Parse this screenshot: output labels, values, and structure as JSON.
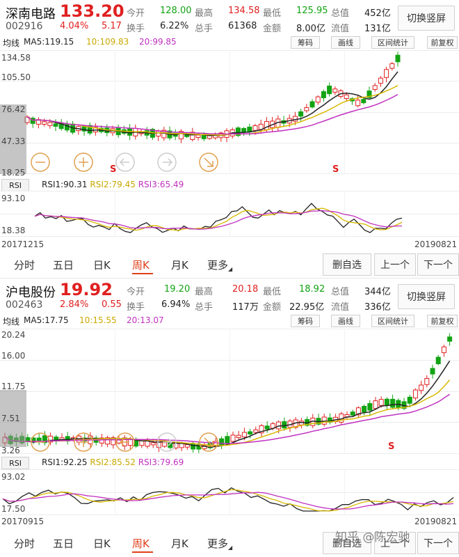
{
  "panels": [
    {
      "name": "深南电路",
      "code": "002916",
      "price": "133.20",
      "pct": "4.04%",
      "change": "5.17",
      "stats": [
        {
          "label": "今开",
          "value": "128.00",
          "color": "green"
        },
        {
          "label": "最高",
          "value": "134.58",
          "color": "red"
        },
        {
          "label": "最低",
          "value": "125.95",
          "color": "green"
        },
        {
          "label": "总值",
          "value": "452亿",
          "color": "dark"
        },
        {
          "label": "换手",
          "value": "6.22%",
          "color": "dark"
        },
        {
          "label": "总手",
          "value": "61368",
          "color": "dark"
        },
        {
          "label": "金额",
          "value": "8.00亿",
          "color": "dark"
        },
        {
          "label": "流值",
          "value": "131亿",
          "color": "dark"
        }
      ],
      "switch_label": "切换竖屏",
      "ma": {
        "label": "均线",
        "ma5": "MA5:119.15",
        "ma10": "10:109.83",
        "ma20": "20:99.85"
      },
      "tools": [
        "筹码",
        "画线",
        "区间统计",
        "前复权"
      ],
      "y_labels": [
        "134.58",
        "105.50",
        "76.42",
        "47.33",
        "18.25"
      ],
      "rsi": {
        "tag": "RSI",
        "r1": "RSI1:90.31",
        "r2": "RSI2:79.45",
        "r3": "RSI3:65.49",
        "top": "93.10",
        "bot": "18.38"
      },
      "date_start": "20171215",
      "date_end": "20190821",
      "marker": "S"
    },
    {
      "name": "沪电股份",
      "code": "002463",
      "price": "19.92",
      "pct": "2.84%",
      "change": "0.55",
      "stats": [
        {
          "label": "今开",
          "value": "19.20",
          "color": "green"
        },
        {
          "label": "最高",
          "value": "20.18",
          "color": "red"
        },
        {
          "label": "最低",
          "value": "18.92",
          "color": "green"
        },
        {
          "label": "总值",
          "value": "344亿",
          "color": "dark"
        },
        {
          "label": "换手",
          "value": "6.94%",
          "color": "dark"
        },
        {
          "label": "总手",
          "value": "117万",
          "color": "dark"
        },
        {
          "label": "金额",
          "value": "22.95亿",
          "color": "dark"
        },
        {
          "label": "流值",
          "value": "336亿",
          "color": "dark"
        }
      ],
      "switch_label": "切换竖屏",
      "ma": {
        "label": "均线",
        "ma5": "MA5:17.75",
        "ma10": "10:15.55",
        "ma20": "20:13.07"
      },
      "tools": [
        "筹码",
        "画线",
        "区间统计",
        "前复权"
      ],
      "y_labels": [
        "20.24",
        "16.00",
        "11.75",
        "7.51",
        "3.26"
      ],
      "rsi": {
        "tag": "RSI",
        "r1": "RSI1:92.25",
        "r2": "RSI2:85.52",
        "r3": "RSI3:79.69",
        "top": "93.02",
        "bot": "17.50"
      },
      "date_start": "20170915",
      "date_end": "20190821",
      "marker": "S"
    }
  ],
  "tabs": [
    "分时",
    "五日",
    "日K",
    "周K",
    "月K",
    "更多"
  ],
  "active_tab": "周K",
  "actions": [
    "删自选",
    "上一个",
    "下一个"
  ],
  "watermark": "知乎 @陈宏驰",
  "colors": {
    "up": "#e02020",
    "down": "#13a313",
    "ma5": "#222222",
    "ma10": "#d8b800",
    "ma20": "#c030c0"
  }
}
